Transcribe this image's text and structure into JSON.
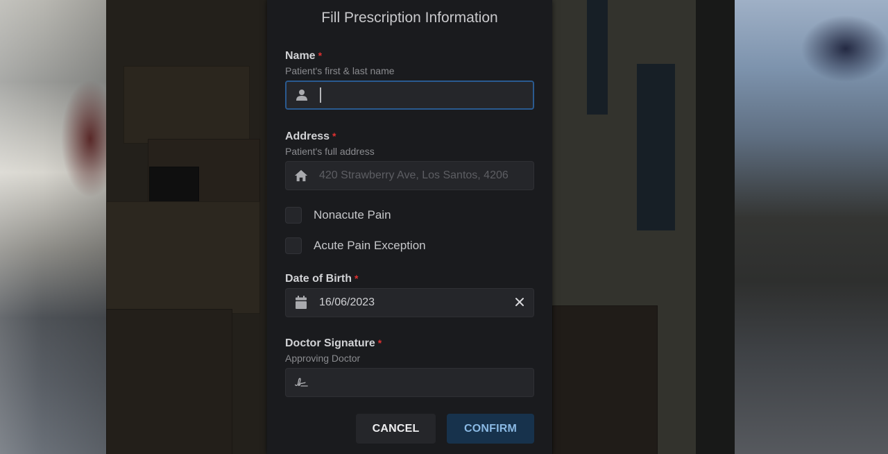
{
  "modal": {
    "title": "Fill Prescription Information",
    "fields": {
      "name": {
        "label": "Name",
        "required_mark": "*",
        "description": "Patient's first & last name",
        "value": "",
        "icon": "user-icon"
      },
      "address": {
        "label": "Address",
        "required_mark": "*",
        "description": "Patient's full address",
        "placeholder": "420 Strawberry Ave, Los Santos, 4206",
        "value": "",
        "icon": "home-icon"
      },
      "date_of_birth": {
        "label": "Date of Birth",
        "required_mark": "*",
        "value": "16/06/2023",
        "icon": "calendar-icon",
        "clear_icon": "close-icon"
      },
      "doctor_signature": {
        "label": "Doctor Signature",
        "required_mark": "*",
        "description": "Approving Doctor",
        "value": "",
        "icon": "signature-icon"
      }
    },
    "checkboxes": [
      {
        "label": "Nonacute Pain",
        "checked": false
      },
      {
        "label": "Acute Pain Exception",
        "checked": false
      }
    ],
    "buttons": {
      "cancel": "CANCEL",
      "confirm": "CONFIRM"
    }
  },
  "colors": {
    "modal_bg": "#1a1b1e",
    "input_bg": "#25262a",
    "focus_border": "#2a5a90",
    "required": "#e03131",
    "confirm_bg": "#17324c",
    "confirm_text": "#8ab9e4"
  }
}
